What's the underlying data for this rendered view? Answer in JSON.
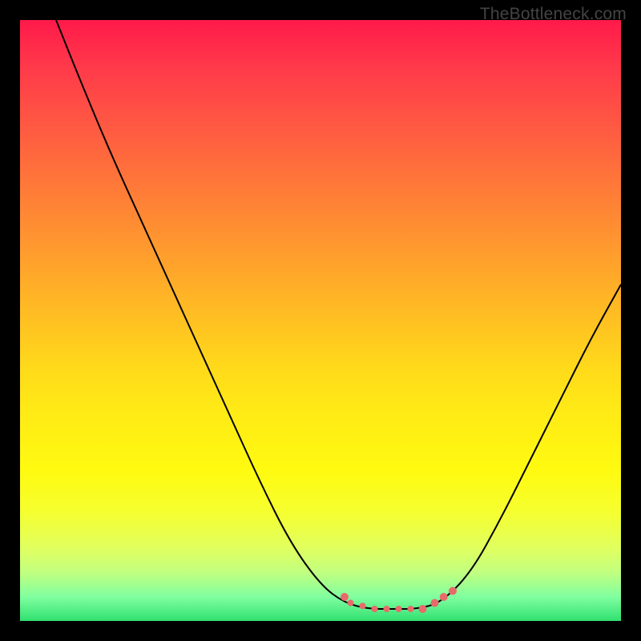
{
  "watermark": "TheBottleneck.com",
  "chart_data": {
    "type": "line",
    "title": "",
    "xlabel": "",
    "ylabel": "",
    "xlim": [
      0,
      100
    ],
    "ylim": [
      0,
      100
    ],
    "grid": false,
    "curve": {
      "name": "bottleneck-curve",
      "color": "#000",
      "width": 2,
      "points": [
        {
          "x": 6,
          "y": 100
        },
        {
          "x": 10,
          "y": 90
        },
        {
          "x": 15,
          "y": 78
        },
        {
          "x": 20,
          "y": 67
        },
        {
          "x": 25,
          "y": 56
        },
        {
          "x": 30,
          "y": 45
        },
        {
          "x": 35,
          "y": 34
        },
        {
          "x": 40,
          "y": 23
        },
        {
          "x": 45,
          "y": 13
        },
        {
          "x": 50,
          "y": 6
        },
        {
          "x": 54,
          "y": 3
        },
        {
          "x": 58,
          "y": 2
        },
        {
          "x": 62,
          "y": 2
        },
        {
          "x": 66,
          "y": 2
        },
        {
          "x": 70,
          "y": 3
        },
        {
          "x": 75,
          "y": 8
        },
        {
          "x": 80,
          "y": 17
        },
        {
          "x": 85,
          "y": 27
        },
        {
          "x": 90,
          "y": 37
        },
        {
          "x": 95,
          "y": 47
        },
        {
          "x": 100,
          "y": 56
        }
      ]
    },
    "highlight": {
      "name": "optimal-zone",
      "color": "#e86a6a",
      "points": [
        {
          "x": 54,
          "y": 4,
          "r": 5
        },
        {
          "x": 55,
          "y": 3,
          "r": 4
        },
        {
          "x": 57,
          "y": 2.5,
          "r": 4
        },
        {
          "x": 59,
          "y": 2,
          "r": 4
        },
        {
          "x": 61,
          "y": 2,
          "r": 4
        },
        {
          "x": 63,
          "y": 2,
          "r": 4
        },
        {
          "x": 65,
          "y": 2,
          "r": 4
        },
        {
          "x": 67,
          "y": 2,
          "r": 5
        },
        {
          "x": 69,
          "y": 3,
          "r": 5
        },
        {
          "x": 70.5,
          "y": 4,
          "r": 5
        },
        {
          "x": 72,
          "y": 5,
          "r": 5
        }
      ]
    }
  }
}
